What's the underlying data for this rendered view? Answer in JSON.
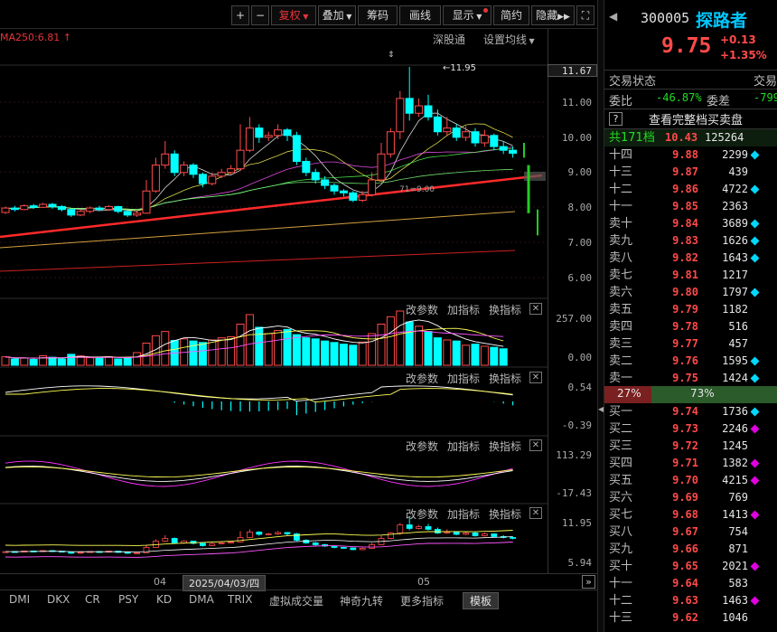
{
  "toolbar": {
    "plus": "+",
    "minus": "−",
    "fuquan": "复权",
    "diejia": "叠加",
    "chouma": "筹码",
    "huaxian": "画线",
    "xianshi": "显示",
    "jianyue": "简约",
    "yincang": "隐藏",
    "fullscreen": "⛶"
  },
  "main_chart": {
    "ma250_label": "MA250:6.81",
    "shentong": "深股通",
    "shezhi": "设置均线",
    "high_label": "11.95",
    "low_label": "71=9.00",
    "price_box": "11.67",
    "axis": [
      "11.00",
      "10.00",
      "9.00",
      "8.00",
      "7.00",
      "6.00"
    ]
  },
  "sub_panels": [
    {
      "gaicanshu": "改参数",
      "jiazhibiao": "加指标",
      "huanzhibiao": "换指标",
      "axis_top": "257.00",
      "axis_bottom": "0.00"
    },
    {
      "gaicanshu": "改参数",
      "jiazhibiao": "加指标",
      "huanzhibiao": "换指标",
      "axis_top": "0.54",
      "axis_bottom": "-0.39"
    },
    {
      "gaicanshu": "改参数",
      "jiazhibiao": "加指标",
      "huanzhibiao": "换指标",
      "axis_top": "113.29",
      "axis_bottom": "-17.43"
    },
    {
      "gaicanshu": "改参数",
      "jiazhibiao": "加指标",
      "huanzhibiao": "换指标",
      "axis_top": "11.95",
      "axis_bottom": "5.94"
    }
  ],
  "timebar": {
    "m1": "04",
    "cursor_date": "2025/04/03/四",
    "m2": "05",
    "nav": "»"
  },
  "tabs": [
    "DMI",
    "DKX",
    "CR",
    "PSY",
    "KD",
    "DMA",
    "TRIX",
    "虚拟成交量",
    "神奇九转",
    "更多指标",
    "模板"
  ],
  "stock": {
    "code": "300005",
    "name": "探路者",
    "price": "9.75",
    "change": "+0.13",
    "change_pct": "+1.35%"
  },
  "status": {
    "trade_status": "交易状态",
    "trade_status2": "交易",
    "weibi_label": "委比",
    "weibi_value": "-46.87%",
    "weicha_label": "委差",
    "weicha_value": "-799",
    "help": "?",
    "view_full": "查看完整档买卖盘",
    "total_label": "共171档",
    "total_price": "10.43",
    "total_vol": "125264"
  },
  "sell_levels": [
    {
      "label": "十四",
      "price": "9.88",
      "vol": "2299",
      "mark": "#00d8ff"
    },
    {
      "label": "十三",
      "price": "9.87",
      "vol": "439",
      "mark": ""
    },
    {
      "label": "十二",
      "price": "9.86",
      "vol": "4722",
      "mark": "#00d8ff"
    },
    {
      "label": "十一",
      "price": "9.85",
      "vol": "2363",
      "mark": ""
    },
    {
      "label": "卖十",
      "price": "9.84",
      "vol": "3689",
      "mark": "#00d8ff"
    },
    {
      "label": "卖九",
      "price": "9.83",
      "vol": "1626",
      "mark": "#00d8ff"
    },
    {
      "label": "卖八",
      "price": "9.82",
      "vol": "1643",
      "mark": "#00d8ff"
    },
    {
      "label": "卖七",
      "price": "9.81",
      "vol": "1217",
      "mark": ""
    },
    {
      "label": "卖六",
      "price": "9.80",
      "vol": "1797",
      "mark": "#00d8ff"
    },
    {
      "label": "卖五",
      "price": "9.79",
      "vol": "1182",
      "mark": ""
    },
    {
      "label": "卖四",
      "price": "9.78",
      "vol": "516",
      "mark": ""
    },
    {
      "label": "卖三",
      "price": "9.77",
      "vol": "457",
      "mark": ""
    },
    {
      "label": "卖二",
      "price": "9.76",
      "vol": "1595",
      "mark": "#00d8ff"
    },
    {
      "label": "卖一",
      "price": "9.75",
      "vol": "1424",
      "mark": "#00d8ff"
    }
  ],
  "ratio": {
    "left": "27%",
    "right": "73%",
    "left_fraction": 0.27
  },
  "buy_levels": [
    {
      "label": "买一",
      "price": "9.74",
      "vol": "1736",
      "mark": "#00d8ff"
    },
    {
      "label": "买二",
      "price": "9.73",
      "vol": "2246",
      "mark": "#e000e0"
    },
    {
      "label": "买三",
      "price": "9.72",
      "vol": "1245",
      "mark": ""
    },
    {
      "label": "买四",
      "price": "9.71",
      "vol": "1382",
      "mark": "#e000e0"
    },
    {
      "label": "买五",
      "price": "9.70",
      "vol": "4215",
      "mark": "#e000e0"
    },
    {
      "label": "买六",
      "price": "9.69",
      "vol": "769",
      "mark": ""
    },
    {
      "label": "买七",
      "price": "9.68",
      "vol": "1413",
      "mark": "#e000e0"
    },
    {
      "label": "买八",
      "price": "9.67",
      "vol": "754",
      "mark": ""
    },
    {
      "label": "买九",
      "price": "9.66",
      "vol": "871",
      "mark": ""
    },
    {
      "label": "买十",
      "price": "9.65",
      "vol": "2021",
      "mark": "#e000e0"
    },
    {
      "label": "十一",
      "price": "9.64",
      "vol": "583",
      "mark": ""
    },
    {
      "label": "十二",
      "price": "9.63",
      "vol": "1463",
      "mark": "#e000e0"
    },
    {
      "label": "十三",
      "price": "9.62",
      "vol": "1046",
      "mark": ""
    }
  ],
  "colors": {
    "up": "#ff4a4a",
    "down": "#00ffff",
    "price_red": "#ff4a4a",
    "stock_name": "#00c8ff"
  },
  "candles": [
    {
      "o": 8.02,
      "c": 8.14,
      "h": 8.18,
      "l": 7.98
    },
    {
      "o": 8.14,
      "c": 8.1,
      "h": 8.2,
      "l": 8.05
    },
    {
      "o": 8.1,
      "c": 8.2,
      "h": 8.24,
      "l": 8.08
    },
    {
      "o": 8.2,
      "c": 8.16,
      "h": 8.25,
      "l": 8.12
    },
    {
      "o": 8.16,
      "c": 8.24,
      "h": 8.28,
      "l": 8.14
    },
    {
      "o": 8.24,
      "c": 8.18,
      "h": 8.28,
      "l": 8.12
    },
    {
      "o": 8.18,
      "c": 8.1,
      "h": 8.22,
      "l": 8.05
    },
    {
      "o": 8.1,
      "c": 7.95,
      "h": 8.12,
      "l": 7.9
    },
    {
      "o": 7.95,
      "c": 8.05,
      "h": 8.1,
      "l": 7.92
    },
    {
      "o": 8.05,
      "c": 8.14,
      "h": 8.18,
      "l": 8.0
    },
    {
      "o": 8.14,
      "c": 8.1,
      "h": 8.2,
      "l": 8.06
    },
    {
      "o": 8.1,
      "c": 8.18,
      "h": 8.22,
      "l": 8.08
    },
    {
      "o": 8.18,
      "c": 8.05,
      "h": 8.2,
      "l": 8.0
    },
    {
      "o": 8.05,
      "c": 7.95,
      "h": 8.08,
      "l": 7.9
    },
    {
      "o": 7.95,
      "c": 8.0,
      "h": 8.05,
      "l": 7.9
    },
    {
      "o": 8.0,
      "c": 8.6,
      "h": 8.9,
      "l": 7.98
    },
    {
      "o": 8.6,
      "c": 9.3,
      "h": 9.5,
      "l": 8.55
    },
    {
      "o": 9.3,
      "c": 9.6,
      "h": 9.95,
      "l": 9.2
    },
    {
      "o": 9.6,
      "c": 9.1,
      "h": 9.7,
      "l": 9.0
    },
    {
      "o": 9.1,
      "c": 9.3,
      "h": 9.4,
      "l": 9.0
    },
    {
      "o": 9.3,
      "c": 9.05,
      "h": 9.35,
      "l": 8.95
    },
    {
      "o": 9.05,
      "c": 8.8,
      "h": 9.1,
      "l": 8.7
    },
    {
      "o": 8.8,
      "c": 9.0,
      "h": 9.1,
      "l": 8.75
    },
    {
      "o": 9.0,
      "c": 9.1,
      "h": 9.2,
      "l": 8.95
    },
    {
      "o": 9.1,
      "c": 9.2,
      "h": 9.3,
      "l": 9.05
    },
    {
      "o": 9.2,
      "c": 9.7,
      "h": 10.4,
      "l": 9.15
    },
    {
      "o": 9.7,
      "c": 10.3,
      "h": 10.6,
      "l": 9.65
    },
    {
      "o": 10.3,
      "c": 10.05,
      "h": 10.4,
      "l": 9.9
    },
    {
      "o": 10.05,
      "c": 10.1,
      "h": 10.2,
      "l": 9.95
    },
    {
      "o": 10.1,
      "c": 10.25,
      "h": 10.4,
      "l": 10.0
    },
    {
      "o": 10.25,
      "c": 10.1,
      "h": 10.3,
      "l": 9.95
    },
    {
      "o": 10.1,
      "c": 9.4,
      "h": 10.2,
      "l": 9.3
    },
    {
      "o": 9.4,
      "c": 9.1,
      "h": 9.5,
      "l": 9.0
    },
    {
      "o": 9.1,
      "c": 8.9,
      "h": 9.2,
      "l": 8.8
    },
    {
      "o": 8.9,
      "c": 8.75,
      "h": 9.0,
      "l": 8.65
    },
    {
      "o": 8.75,
      "c": 8.6,
      "h": 8.8,
      "l": 8.5
    },
    {
      "o": 8.6,
      "c": 8.55,
      "h": 8.65,
      "l": 8.45
    },
    {
      "o": 8.55,
      "c": 8.35,
      "h": 8.6,
      "l": 8.3
    },
    {
      "o": 8.35,
      "c": 8.5,
      "h": 8.6,
      "l": 8.3
    },
    {
      "o": 8.5,
      "c": 8.9,
      "h": 9.1,
      "l": 8.45
    },
    {
      "o": 8.9,
      "c": 9.6,
      "h": 9.9,
      "l": 8.85
    },
    {
      "o": 9.6,
      "c": 10.2,
      "h": 10.3,
      "l": 9.5
    },
    {
      "o": 10.2,
      "c": 11.1,
      "h": 11.3,
      "l": 10.0
    },
    {
      "o": 11.1,
      "c": 10.7,
      "h": 11.95,
      "l": 10.5
    },
    {
      "o": 10.7,
      "c": 10.9,
      "h": 11.1,
      "l": 10.6
    },
    {
      "o": 10.9,
      "c": 10.6,
      "h": 11.2,
      "l": 10.5
    },
    {
      "o": 10.6,
      "c": 10.2,
      "h": 10.8,
      "l": 10.1
    },
    {
      "o": 10.2,
      "c": 10.3,
      "h": 10.6,
      "l": 10.1
    },
    {
      "o": 10.3,
      "c": 10.05,
      "h": 10.4,
      "l": 9.95
    },
    {
      "o": 10.05,
      "c": 10.2,
      "h": 10.35,
      "l": 9.95
    },
    {
      "o": 10.2,
      "c": 9.9,
      "h": 10.3,
      "l": 9.8
    },
    {
      "o": 9.9,
      "c": 10.1,
      "h": 10.25,
      "l": 9.8
    },
    {
      "o": 10.1,
      "c": 9.8,
      "h": 10.15,
      "l": 9.7
    },
    {
      "o": 9.8,
      "c": 9.7,
      "h": 9.95,
      "l": 9.6
    },
    {
      "o": 9.7,
      "c": 9.62,
      "h": 9.8,
      "l": 9.5
    }
  ],
  "volumes": [
    40,
    30,
    35,
    28,
    45,
    38,
    30,
    52,
    44,
    36,
    34,
    40,
    30,
    35,
    60,
    105,
    140,
    160,
    118,
    125,
    115,
    108,
    120,
    130,
    135,
    195,
    240,
    180,
    150,
    165,
    170,
    145,
    130,
    125,
    115,
    108,
    100,
    95,
    110,
    150,
    195,
    230,
    257,
    205,
    185,
    160,
    130,
    120,
    115,
    95,
    100,
    90,
    85,
    78
  ]
}
